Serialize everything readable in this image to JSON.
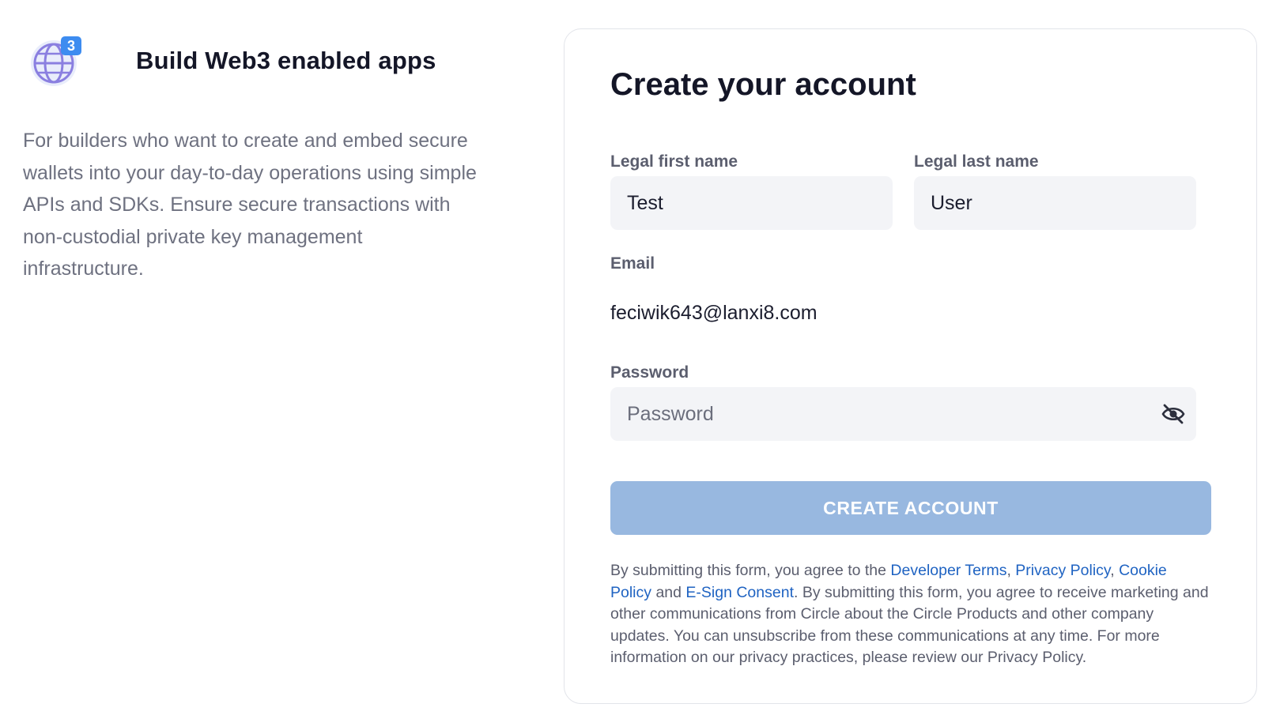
{
  "feature": {
    "icon": "globe-web3-icon",
    "badge": "3",
    "title": "Build Web3 enabled apps",
    "description": "For builders who want to create and embed secure wallets into your day-to-day operations using simple APIs and SDKs. Ensure secure transactions with non-custodial private key management infrastructure."
  },
  "form": {
    "title": "Create your account",
    "first_name": {
      "label": "Legal first name",
      "value": "Test"
    },
    "last_name": {
      "label": "Legal last name",
      "value": "User"
    },
    "email": {
      "label": "Email",
      "value": "feciwik643@lanxi8.com"
    },
    "password": {
      "label": "Password",
      "placeholder": "Password",
      "toggle_icon": "eye-off-icon"
    },
    "submit_label": "CREATE ACCOUNT",
    "legal": {
      "t1": "By submitting this form, you agree to the ",
      "link_developer_terms": "Developer Terms",
      "t2": ", ",
      "link_privacy_policy": "Privacy Policy",
      "t3": ", ",
      "link_cookie_policy": "Cookie Policy",
      "t4": " and ",
      "link_esign": "E-Sign Consent",
      "t5": ". By submitting this form, you agree to receive marketing and other communications from Circle about the Circle Products and other company updates. You can unsubscribe from these communications at any time. For more information on our privacy practices, please review our Privacy Policy."
    }
  },
  "colors": {
    "primary_button_disabled": "#98b8e0",
    "link": "#1f63c2",
    "badge": "#3d8cf0",
    "input_bg": "#f3f4f7"
  }
}
